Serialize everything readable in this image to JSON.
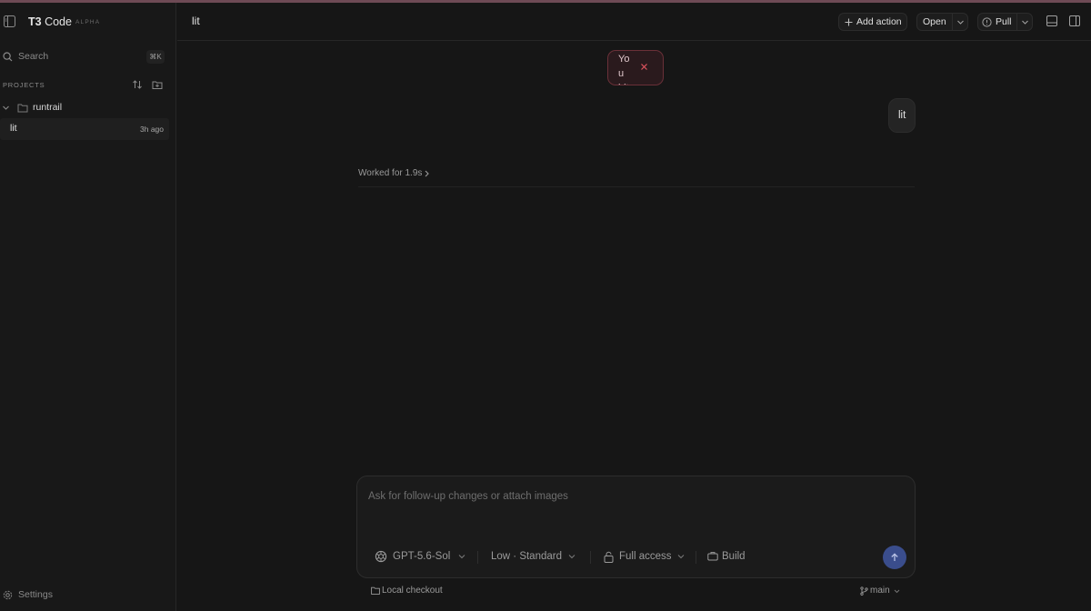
{
  "app": {
    "brand_bold": "T3",
    "brand_rest": " Code",
    "badge": "ALPHA"
  },
  "sidebar": {
    "search_label": "Search",
    "search_shortcut": "⌘K",
    "projects_heading": "PROJECTS",
    "projects": [
      {
        "name": "runtrail",
        "threads": [
          {
            "title": "lit",
            "time": "3h ago"
          }
        ]
      }
    ],
    "settings_label": "Settings"
  },
  "header": {
    "thread_title": "lit",
    "add_action_label": "Add action",
    "open_label": "Open",
    "pull_label": "Pull"
  },
  "toast": {
    "message": "You hit y…"
  },
  "conversation": {
    "user_message": "lit",
    "worked_label": "Worked for 1.9s"
  },
  "composer": {
    "placeholder": "Ask for follow-up changes or attach images",
    "model": "GPT-5.6-Sol",
    "effort": "Low · Standard",
    "access": "Full access",
    "mode": "Build"
  },
  "footer": {
    "checkout_label": "Local checkout",
    "branch": "main"
  },
  "colors": {
    "background": "#161616",
    "sidebar": "#181818",
    "accent_send": "#3a4d8c",
    "toast_border": "#6a3038",
    "toast_close": "#e0555f"
  },
  "icons": {
    "sidebar_toggle": "sidebar-toggle-icon",
    "search": "search-icon",
    "sort": "sort-icon",
    "new_folder": "new-folder-icon",
    "folder": "folder-icon",
    "settings": "gear-icon",
    "add": "plus-icon",
    "pull": "info-circle-icon",
    "close": "close-icon",
    "model": "openai-icon",
    "lock": "lock-icon",
    "build": "briefcase-icon",
    "send": "arrow-up-icon",
    "branch": "git-branch-icon"
  }
}
